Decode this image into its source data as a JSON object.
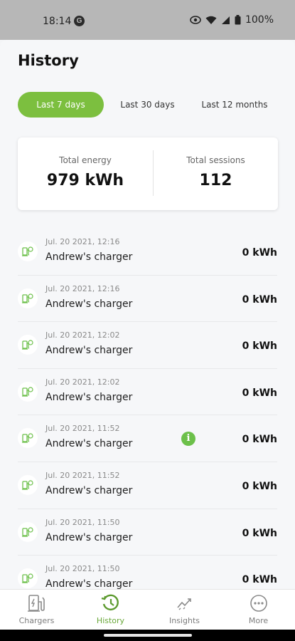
{
  "status_bar": {
    "time": "18:14",
    "battery": "100%"
  },
  "page": {
    "title": "History"
  },
  "tabs": [
    {
      "label": "Last 7 days",
      "active": true
    },
    {
      "label": "Last 30 days",
      "active": false
    },
    {
      "label": "Last 12 months",
      "active": false
    }
  ],
  "summary": {
    "energy_label": "Total energy",
    "energy_value": "979 kWh",
    "sessions_label": "Total sessions",
    "sessions_value": "112"
  },
  "sessions": [
    {
      "date": "Jul. 20 2021, 12:16",
      "charger": "Andrew's charger",
      "energy": "0 kWh",
      "info": false
    },
    {
      "date": "Jul. 20 2021, 12:16",
      "charger": "Andrew's charger",
      "energy": "0 kWh",
      "info": false
    },
    {
      "date": "Jul. 20 2021, 12:02",
      "charger": "Andrew's charger",
      "energy": "0 kWh",
      "info": false
    },
    {
      "date": "Jul. 20 2021, 12:02",
      "charger": "Andrew's charger",
      "energy": "0 kWh",
      "info": false
    },
    {
      "date": "Jul. 20 2021, 11:52",
      "charger": "Andrew's charger",
      "energy": "0 kWh",
      "info": true
    },
    {
      "date": "Jul. 20 2021, 11:52",
      "charger": "Andrew's charger",
      "energy": "0 kWh",
      "info": false
    },
    {
      "date": "Jul. 20 2021, 11:50",
      "charger": "Andrew's charger",
      "energy": "0 kWh",
      "info": false
    },
    {
      "date": "Jul. 20 2021, 11:50",
      "charger": "Andrew's charger",
      "energy": "0 kWh",
      "info": false
    }
  ],
  "bottom_nav": [
    {
      "label": "Chargers",
      "icon": "charger-icon",
      "active": false
    },
    {
      "label": "History",
      "icon": "history-icon",
      "active": true
    },
    {
      "label": "Insights",
      "icon": "insights-icon",
      "active": false
    },
    {
      "label": "More",
      "icon": "more-icon",
      "active": false
    }
  ],
  "colors": {
    "accent": "#7cbf3f",
    "info": "#6cc04a"
  }
}
